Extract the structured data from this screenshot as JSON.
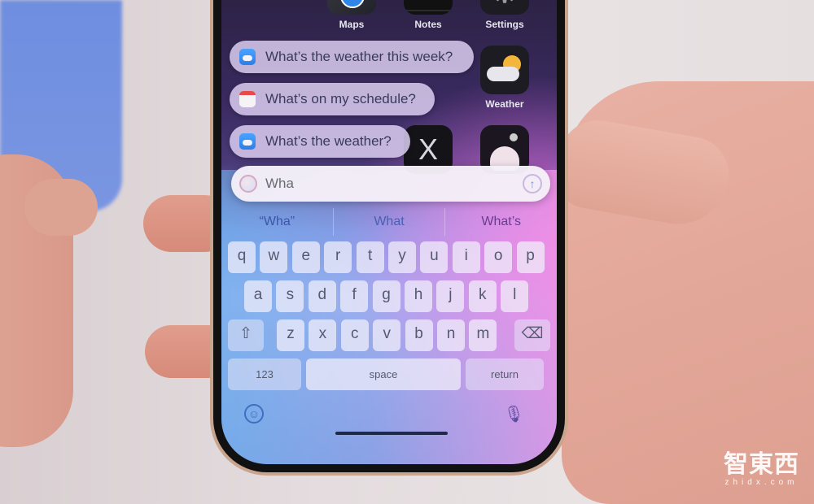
{
  "home_screen": {
    "apps": [
      {
        "label": "Maps",
        "icon": "maps-icon"
      },
      {
        "label": "Notes",
        "icon": "notes-icon"
      },
      {
        "label": "Settings",
        "icon": "settings-icon"
      },
      {
        "label": "Weather",
        "icon": "weather-icon"
      },
      {
        "label": "",
        "icon": "x-app-icon",
        "glyph": "X"
      },
      {
        "label": "",
        "icon": "reddit-icon"
      }
    ]
  },
  "siri_suggestions": [
    {
      "text": "What’s the weather this week?",
      "icon": "weather-app-icon"
    },
    {
      "text": "What’s on my schedule?",
      "icon": "calendar-app-icon"
    },
    {
      "text": "What’s the weather?",
      "icon": "weather-app-icon"
    }
  ],
  "siri_input": {
    "value": "Wha",
    "send_glyph": "↑"
  },
  "predictions": [
    "“Wha”",
    "What",
    "What’s"
  ],
  "keyboard": {
    "row1": [
      "q",
      "w",
      "e",
      "r",
      "t",
      "y",
      "u",
      "i",
      "o",
      "p"
    ],
    "row2": [
      "a",
      "s",
      "d",
      "f",
      "g",
      "h",
      "j",
      "k",
      "l"
    ],
    "row3": [
      "z",
      "x",
      "c",
      "v",
      "b",
      "n",
      "m"
    ],
    "shift_glyph": "⇧",
    "delete_glyph": "⌫",
    "numbers_label": "123",
    "space_label": "space",
    "return_label": "return",
    "emoji_glyph": "☺",
    "mic_glyph": "🎙"
  },
  "watermark": {
    "name": "智東西",
    "domain": "zhidx.com"
  }
}
